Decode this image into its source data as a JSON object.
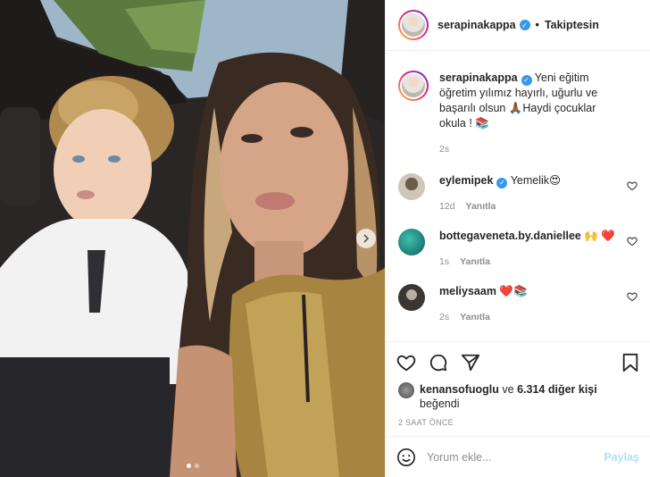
{
  "post": {
    "carousel": {
      "slide_count": 2,
      "active_slide": 1
    }
  },
  "header": {
    "username": "serapinakappa",
    "separator": "•",
    "follow_status": "Takiptesin"
  },
  "caption": {
    "username": "serapinakappa",
    "text": "Yeni eğitim öğretim yılımız hayırlı, uğurlu ve başarılı olsun 🙏🏾Haydi çocuklar okula ! 📚",
    "time": "2s"
  },
  "comments": [
    {
      "username": "eylemipek",
      "verified": true,
      "text": "Yemelik😍",
      "time": "12d",
      "reply": "Yanıtla"
    },
    {
      "username": "bottegaveneta.by.daniellee",
      "verified": false,
      "text": "🙌 ❤️",
      "time": "1s",
      "reply": "Yanıtla"
    },
    {
      "username": "meliysaam",
      "verified": false,
      "text": "❤️📚",
      "time": "2s",
      "reply": "Yanıtla"
    }
  ],
  "likes": {
    "liker": "kenansofuoglu",
    "connector": "ve",
    "others": "6.314 diğer kişi",
    "suffix": "beğendi"
  },
  "timestamp": "2 SAAT ÖNCE",
  "composer": {
    "placeholder": "Yorum ekle...",
    "post_label": "Paylaş"
  },
  "colors": {
    "verified_blue": "#3897f0",
    "post_button_disabled": "#b2dffc",
    "muted_text": "#8e8e8e"
  }
}
